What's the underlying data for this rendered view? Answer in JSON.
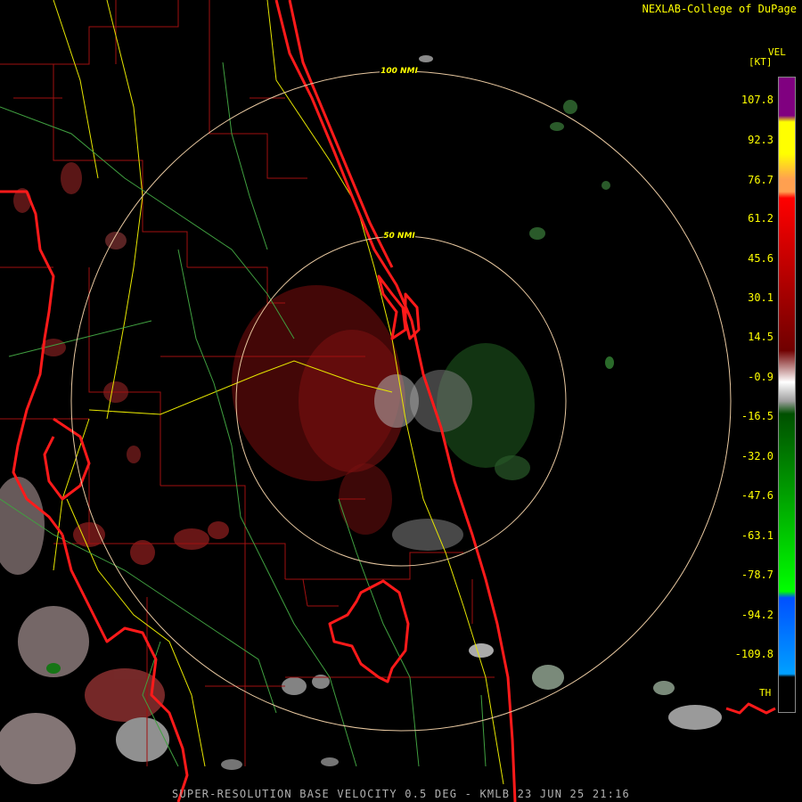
{
  "header": {
    "credit": "NEXLAB-College of DuPage"
  },
  "legend": {
    "title": "VEL",
    "units": "[KT]",
    "ticks": [
      "107.8",
      "92.3",
      "76.7",
      "61.2",
      "45.6",
      "30.1",
      "14.5",
      "-0.9",
      "-16.5",
      "-32.0",
      "-47.6",
      "-63.1",
      "-78.7",
      "-94.2",
      "-109.8"
    ],
    "footer_label": "TH",
    "colors": {
      "purple": "#800080",
      "yellow": "#ffff00",
      "orange": "#ffa050",
      "red": "#ff0000",
      "dark_red": "#700000",
      "gray": "#a0a0a0",
      "dark_green": "#005000",
      "green": "#00ff00",
      "blue": "#0050ff",
      "cyan": "#00a0ff"
    }
  },
  "map": {
    "range_rings": [
      {
        "label": "50 NMI"
      },
      {
        "label": "100 NMI"
      }
    ]
  },
  "status": {
    "product_line": "SUPER-RESOLUTION BASE VELOCITY 0.5 DEG - KMLB 23 JUN 25 21:16"
  }
}
